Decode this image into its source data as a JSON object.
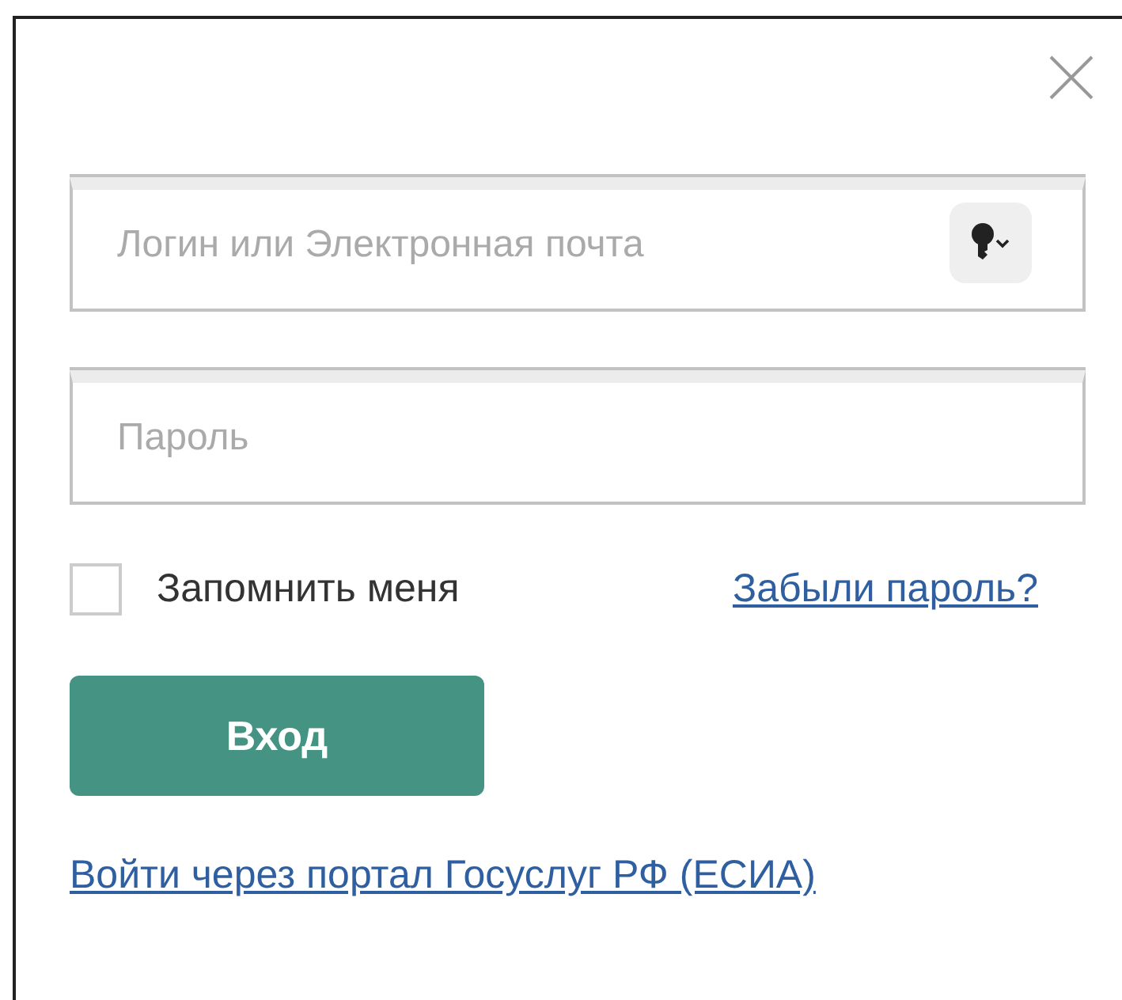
{
  "login_field": {
    "placeholder": "Логин или Электронная почта"
  },
  "password_field": {
    "placeholder": "Пароль"
  },
  "remember": {
    "label": "Запомнить меня",
    "checked": false
  },
  "forgot_link": "Забыли пароль?",
  "submit_button": "Вход",
  "esia_link": "Войти через портал Госуслуг РФ (ЕСИА)"
}
